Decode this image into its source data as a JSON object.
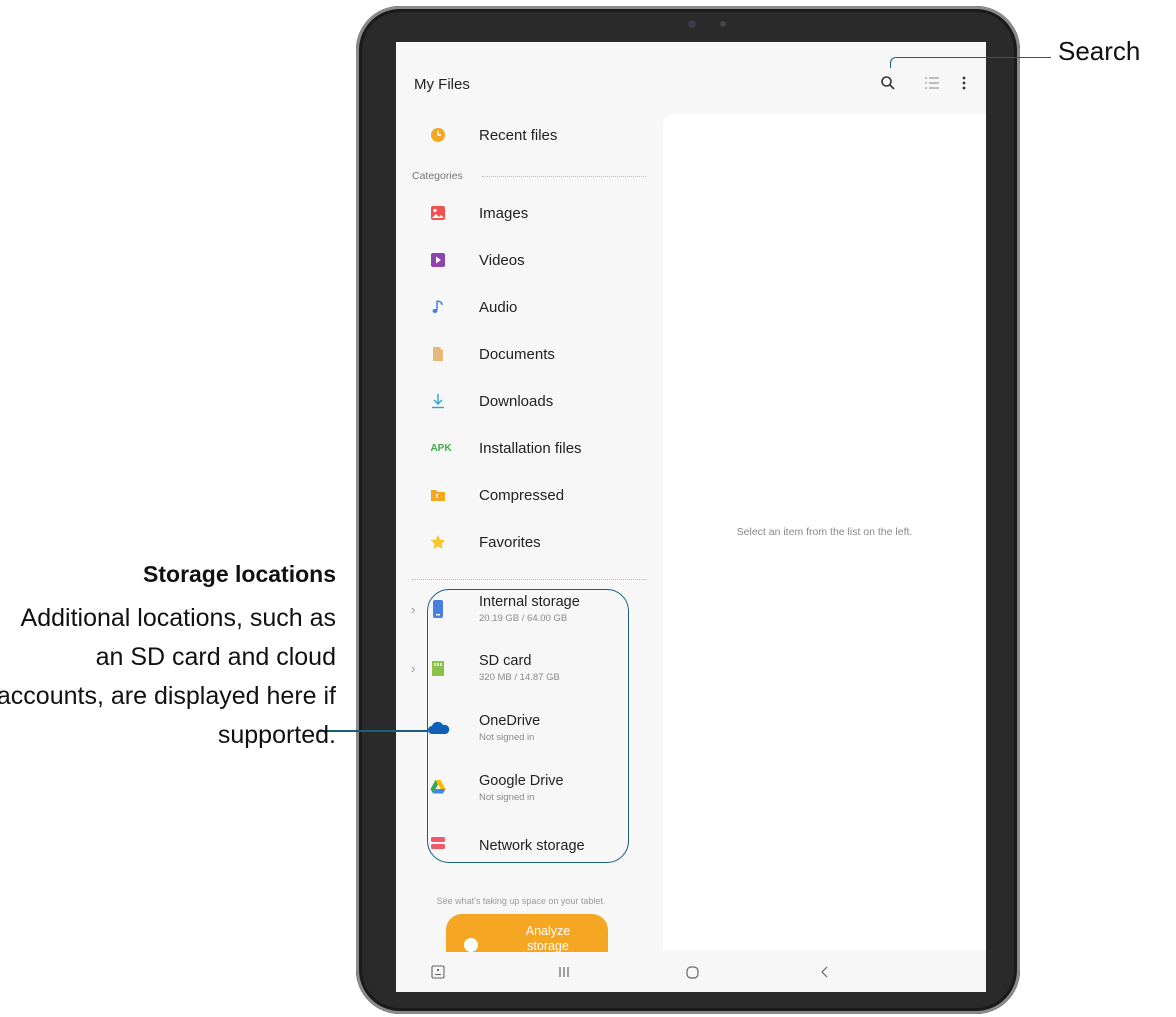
{
  "app": {
    "title": "My Files",
    "header_icons": [
      "search-icon",
      "list-view-icon",
      "more-options-icon"
    ]
  },
  "sidebar": {
    "recent": {
      "label": "Recent files",
      "icon": "clock-icon",
      "color": "#f5a623"
    },
    "categories_label": "Categories",
    "categories": [
      {
        "label": "Images",
        "icon": "image-icon",
        "color": "#ef5350"
      },
      {
        "label": "Videos",
        "icon": "video-icon",
        "color": "#8e44ad"
      },
      {
        "label": "Audio",
        "icon": "music-note-icon",
        "color": "#3f7fe0"
      },
      {
        "label": "Documents",
        "icon": "document-icon",
        "color": "#e3b97a"
      },
      {
        "label": "Downloads",
        "icon": "download-icon",
        "color": "#2aa4d8"
      },
      {
        "label": "Installation files",
        "icon": "apk-icon",
        "color": "#3fae4a",
        "icon_text": "APK"
      },
      {
        "label": "Compressed",
        "icon": "compressed-folder-icon",
        "color": "#f5a623"
      },
      {
        "label": "Favorites",
        "icon": "star-icon",
        "color": "#f7c72b"
      }
    ],
    "storage": [
      {
        "name": "Internal storage",
        "sub": "20.19 GB / 64.00 GB",
        "icon": "phone-storage-icon",
        "color": "#4a7fe0",
        "expandable": true
      },
      {
        "name": "SD card",
        "sub": "320 MB / 14.87 GB",
        "icon": "sd-card-icon",
        "color": "#8bc34a",
        "expandable": true
      },
      {
        "name": "OneDrive",
        "sub": "Not signed in",
        "icon": "onedrive-icon",
        "color": "#0f5fb8",
        "expandable": false
      },
      {
        "name": "Google Drive",
        "sub": "Not signed in",
        "icon": "google-drive-icon",
        "color": "#34a853",
        "expandable": false
      },
      {
        "name": "Network storage",
        "sub": "",
        "icon": "network-storage-icon",
        "color": "#ef5a6a",
        "expandable": false
      }
    ],
    "analyze_hint": "See what's taking up space on your tablet.",
    "analyze_button": "Analyze storage"
  },
  "main": {
    "empty_message": "Select an item from the list on the left."
  },
  "navbar": {
    "icons": [
      "keyboard-icon",
      "recents-icon",
      "home-icon",
      "back-icon"
    ]
  },
  "callouts": {
    "search": "Search",
    "storage_title": "Storage locations",
    "storage_desc": "Additional locations, such as an SD card and cloud accounts, are displayed here if supported.",
    "accent": "#1a5f7a"
  }
}
